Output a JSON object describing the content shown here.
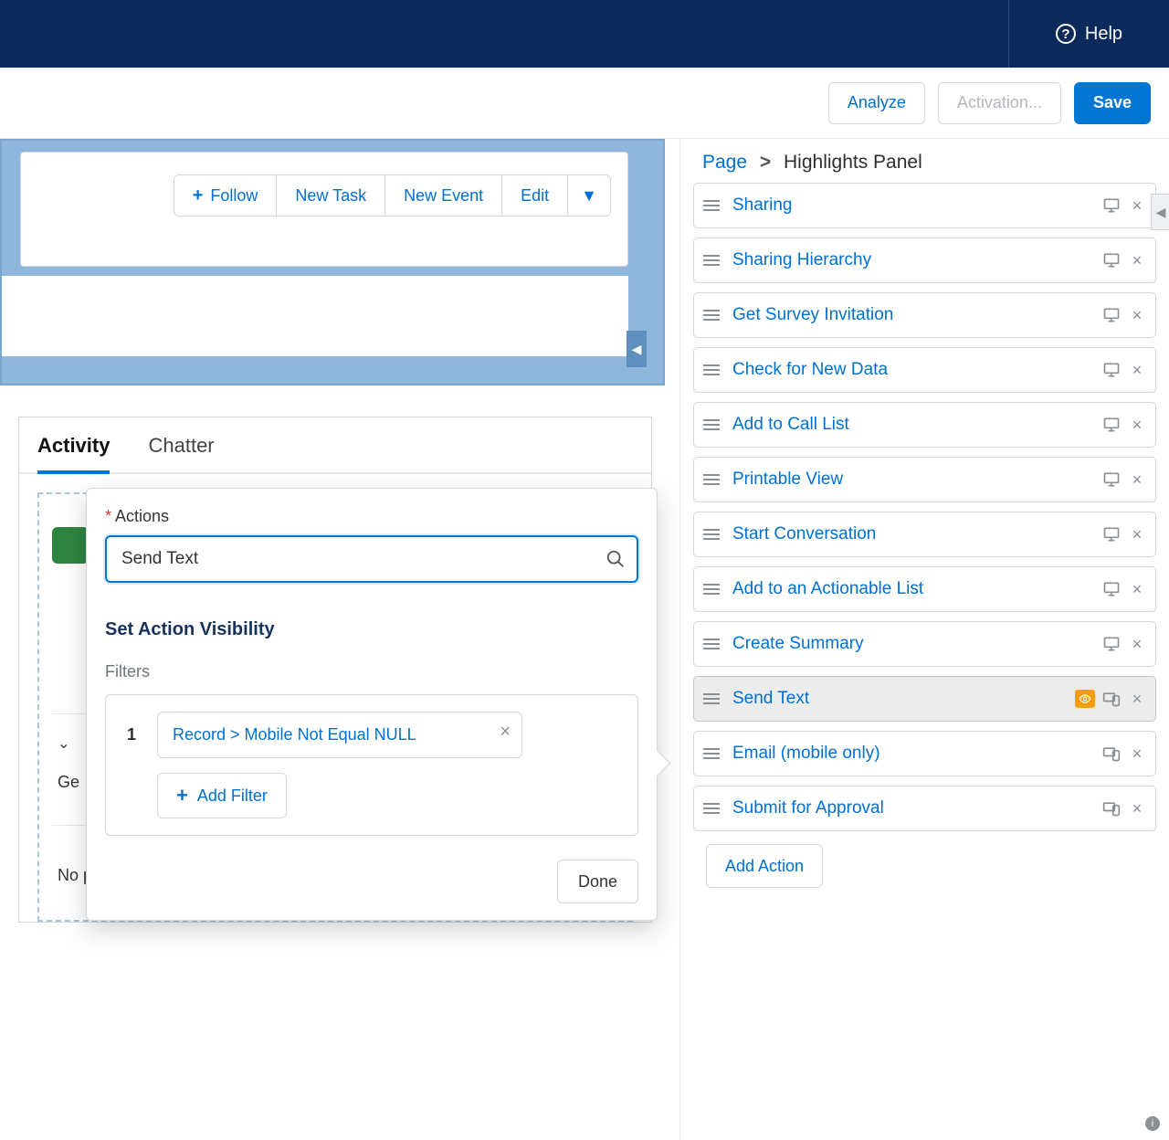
{
  "header": {
    "help_label": "Help"
  },
  "toolbar": {
    "analyze": "Analyze",
    "activation": "Activation...",
    "save": "Save"
  },
  "canvas": {
    "follow": "Follow",
    "new_task": "New Task",
    "new_event": "New Event",
    "edit": "Edit"
  },
  "tabs": {
    "activity": "Activity",
    "chatter": "Chatter"
  },
  "stubs": {
    "g_line": "Ge",
    "no_line": "No p"
  },
  "popover": {
    "actions_label": "Actions",
    "search_value": "Send Text",
    "visibility_heading": "Set Action Visibility",
    "filters_label": "Filters",
    "filter_num": "1",
    "filter_text": "Record > Mobile Not Equal NULL",
    "add_filter": "Add Filter",
    "done": "Done"
  },
  "breadcrumb": {
    "root": "Page",
    "current": "Highlights Panel"
  },
  "actions": [
    {
      "label": "Sharing",
      "kind": "desktop"
    },
    {
      "label": "Sharing Hierarchy",
      "kind": "desktop"
    },
    {
      "label": "Get Survey Invitation",
      "kind": "desktop"
    },
    {
      "label": "Check for New Data",
      "kind": "desktop"
    },
    {
      "label": "Add to Call List",
      "kind": "desktop"
    },
    {
      "label": "Printable View",
      "kind": "desktop"
    },
    {
      "label": "Start Conversation",
      "kind": "desktop"
    },
    {
      "label": "Add to an Actionable List",
      "kind": "desktop"
    },
    {
      "label": "Create Summary",
      "kind": "desktop"
    },
    {
      "label": "Send Text",
      "kind": "selected"
    },
    {
      "label": "Email (mobile only)",
      "kind": "mobile"
    },
    {
      "label": "Submit for Approval",
      "kind": "mobile"
    }
  ],
  "add_action": "Add Action"
}
